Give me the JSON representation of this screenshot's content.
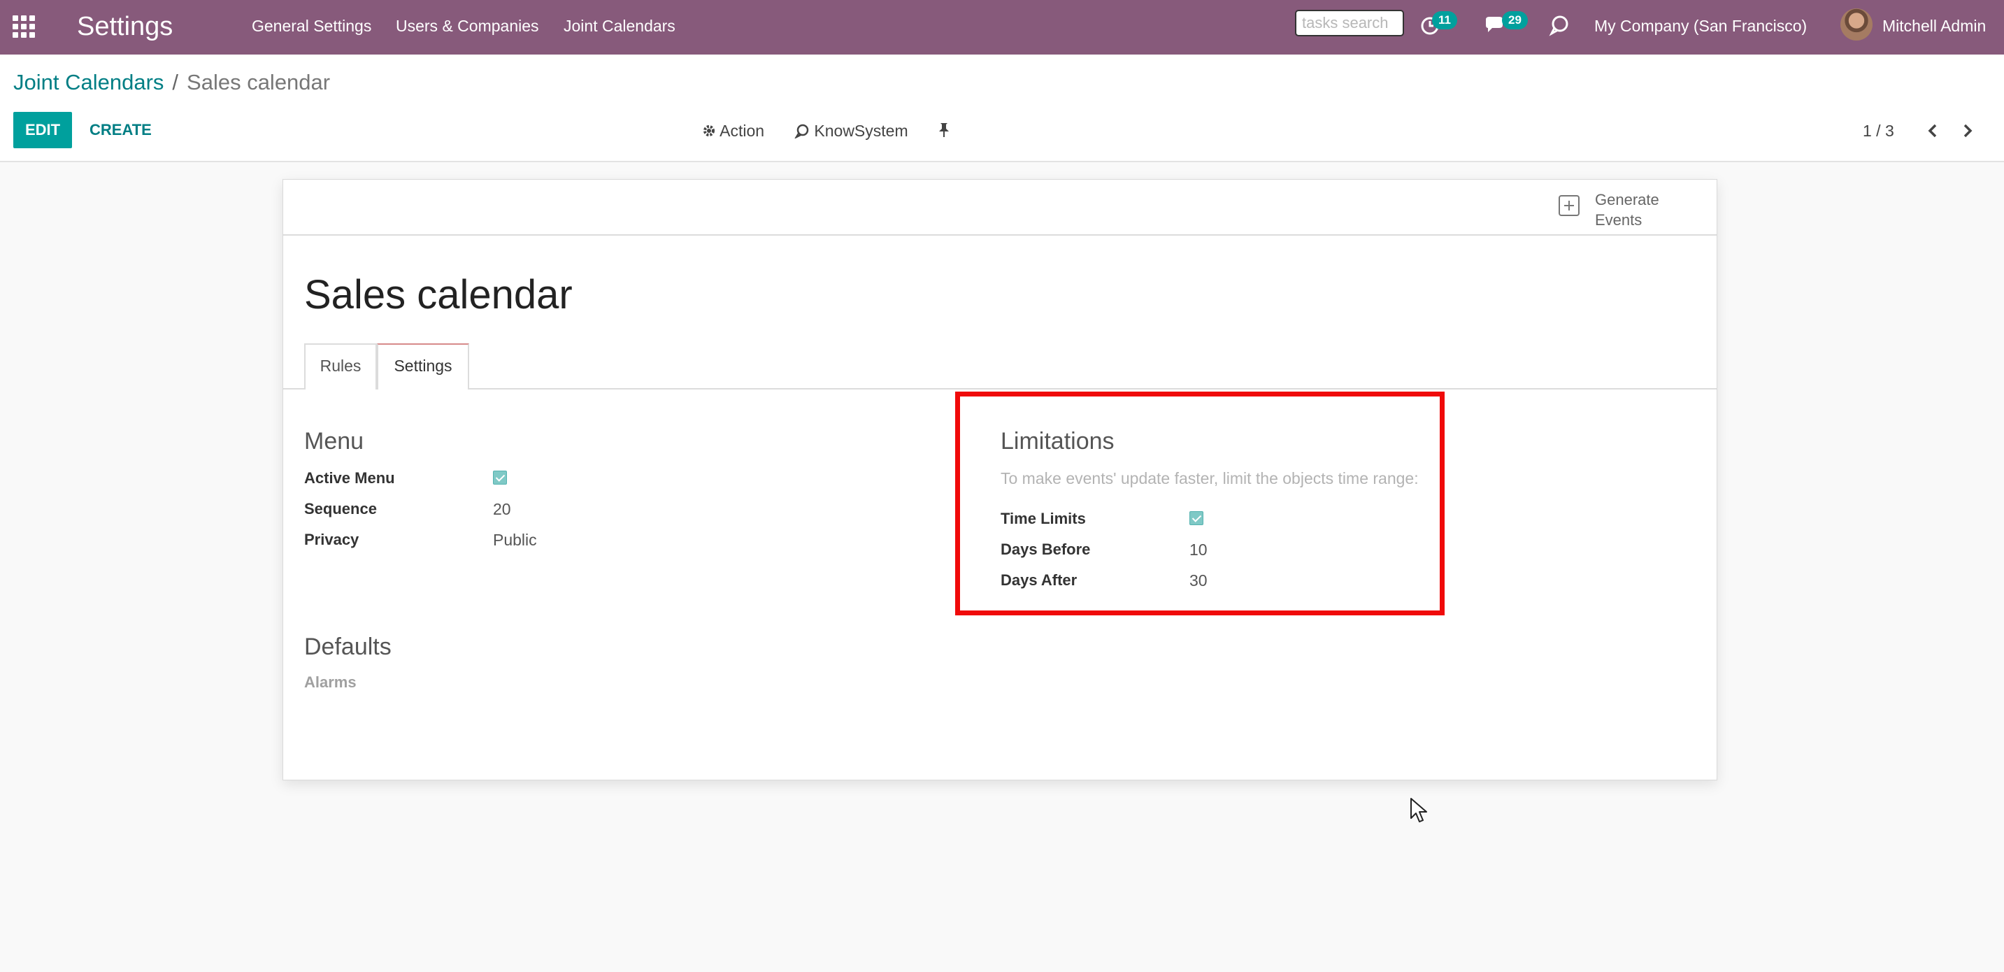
{
  "navbar": {
    "app_name": "Settings",
    "menu": [
      "General Settings",
      "Users & Companies",
      "Joint Calendars"
    ],
    "search_placeholder": "tasks search",
    "activity_count": "11",
    "messages_count": "29",
    "company": "My Company (San Francisco)",
    "user": "Mitchell Admin"
  },
  "breadcrumb": {
    "parent": "Joint Calendars",
    "separator": "/",
    "current": "Sales calendar"
  },
  "toolbar": {
    "edit_label": "EDIT",
    "create_label": "CREATE",
    "action_label": "Action",
    "knowsystem_label": "KnowSystem",
    "pager": "1 / 3"
  },
  "form": {
    "header_button": "Generate Events",
    "title": "Sales calendar",
    "tabs": [
      {
        "label": "Rules",
        "active": false
      },
      {
        "label": "Settings",
        "active": true
      }
    ],
    "menu_group": {
      "title": "Menu",
      "fields": [
        {
          "label": "Active Menu",
          "type": "checkbox",
          "checked": true
        },
        {
          "label": "Sequence",
          "value": "20"
        },
        {
          "label": "Privacy",
          "value": "Public"
        }
      ]
    },
    "limitations_group": {
      "title": "Limitations",
      "help": "To make events' update faster, limit the objects time range:",
      "fields": [
        {
          "label": "Time Limits",
          "type": "checkbox",
          "checked": true
        },
        {
          "label": "Days Before",
          "value": "10"
        },
        {
          "label": "Days After",
          "value": "30"
        }
      ]
    },
    "defaults_group": {
      "title": "Defaults",
      "fields": [
        {
          "label": "Alarms",
          "value": ""
        }
      ]
    }
  },
  "colors": {
    "navbar": "#875a7b",
    "primary": "#00a09d",
    "link": "#017e84",
    "highlight": "#f00a0a"
  },
  "icons": [
    "apps-icon",
    "clock-icon",
    "chat-icon",
    "discuss-icon",
    "gear-icon",
    "knowsystem-icon",
    "pin-icon",
    "chevron-left-icon",
    "chevron-right-icon",
    "plus-square-icon",
    "mouse-cursor-icon"
  ]
}
